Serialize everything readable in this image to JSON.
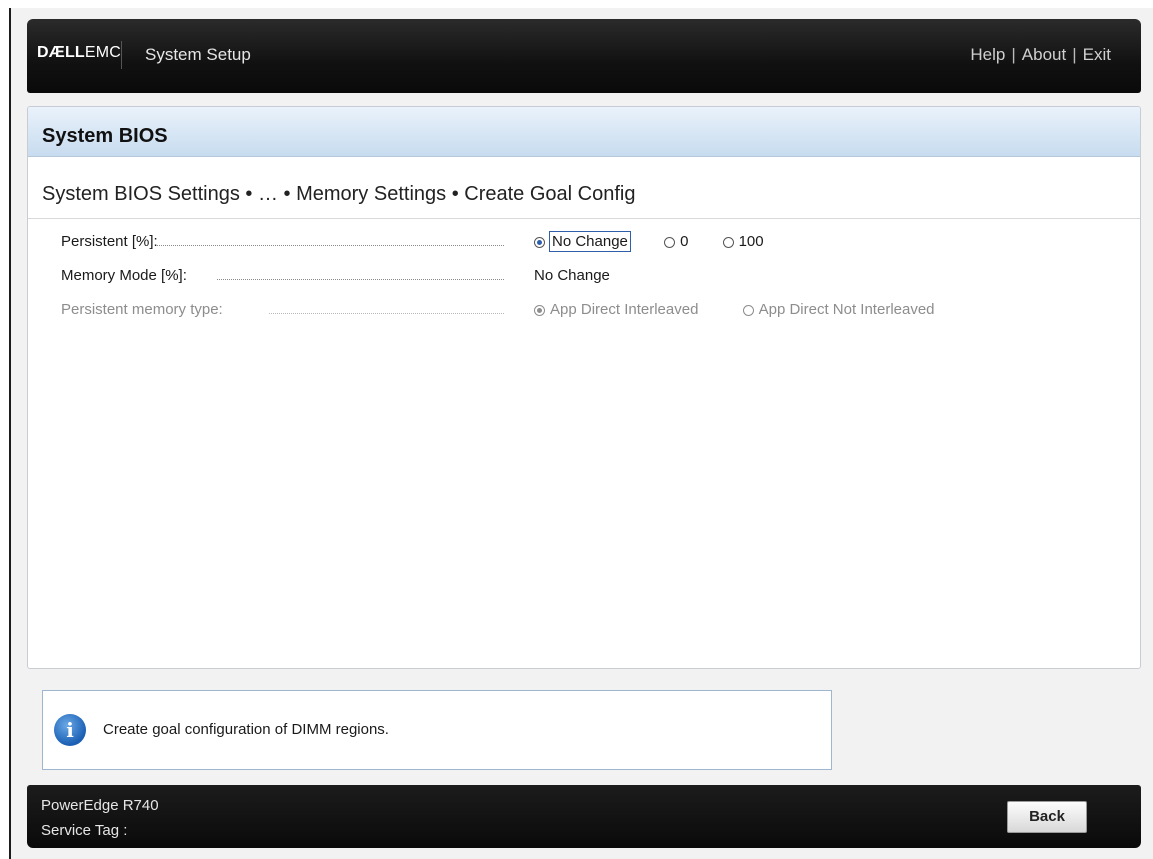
{
  "header": {
    "logo_bold": "DÆLL",
    "logo_light": "EMC",
    "app_title": "System Setup",
    "links": {
      "help": "Help",
      "about": "About",
      "exit": "Exit",
      "separator": "|"
    }
  },
  "panel": {
    "title": "System BIOS",
    "breadcrumb": "System BIOS Settings • … • Memory Settings • Create Goal Config"
  },
  "settings": {
    "persistent": {
      "label": "Persistent [%]:",
      "options": [
        "No Change",
        "0",
        "100"
      ],
      "selected": "No Change"
    },
    "memory_mode": {
      "label": "Memory Mode [%]:",
      "value": "No Change"
    },
    "persistent_memory_type": {
      "label": "Persistent memory type:",
      "options": [
        "App Direct Interleaved",
        "App Direct Not Interleaved"
      ],
      "selected": "App Direct Interleaved",
      "disabled": true
    }
  },
  "help": {
    "icon": "info-icon",
    "text": "Create goal configuration of DIMM regions."
  },
  "footer": {
    "model": "PowerEdge R740",
    "service_tag_label": "Service Tag :",
    "back_label": "Back"
  },
  "colors": {
    "header_bg": "#111111",
    "panel_header": "#c7dcef",
    "accent": "#2f5faa"
  }
}
